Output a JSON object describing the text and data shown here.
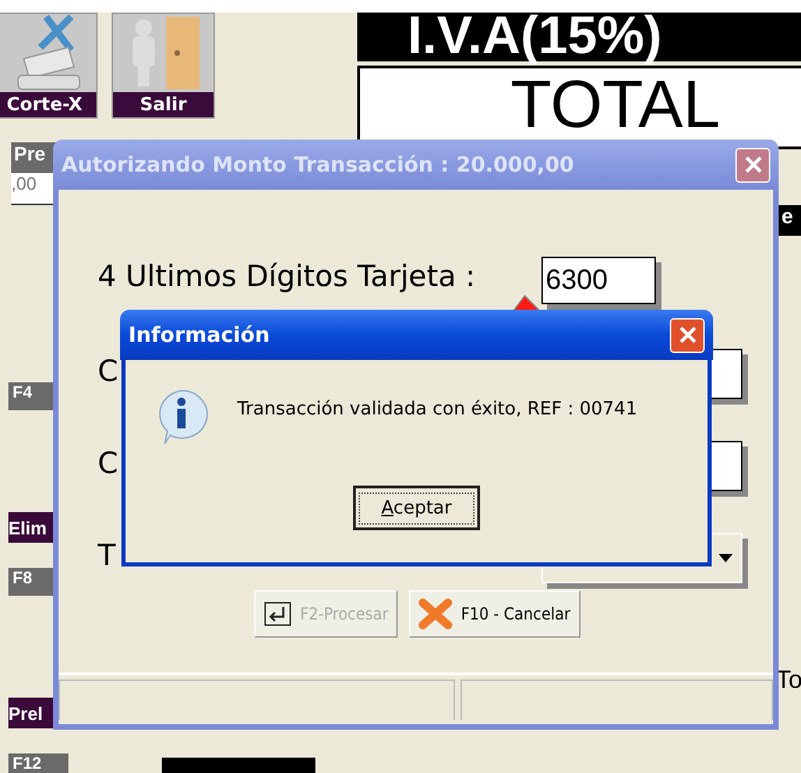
{
  "pos_screen": {
    "toolbar_buttons": [
      {
        "label": "Corte-X",
        "kind": "cut"
      },
      {
        "label": "Salir",
        "kind": "exit"
      }
    ],
    "price_header": "Pre",
    "price_value": ",00",
    "function_keys": [
      {
        "key": "F4",
        "label": "Elim"
      },
      {
        "key": "F8",
        "label": "Prel"
      },
      {
        "key": "F12"
      }
    ],
    "tax_label": "I.V.A(15%)",
    "total_label": "TOTAL",
    "side_header": "e",
    "side_label": "To"
  },
  "auth_dialog": {
    "title": "Autorizando Monto Transacción : 20.000,00",
    "rows": [
      {
        "label": "4 Ultimos Dígitos Tarjeta :",
        "kind": "text",
        "value": "6300"
      },
      {
        "label": "C",
        "kind": "text"
      },
      {
        "label": "C",
        "kind": "text"
      },
      {
        "label": "T",
        "kind": "dropdown"
      }
    ],
    "buttons": [
      {
        "label": "F2-Procesar",
        "kind": "enter",
        "disabled": true
      },
      {
        "label": "F10 - Cancelar",
        "kind": "cancel",
        "disabled": false
      }
    ]
  },
  "info_dialog": {
    "title": "Información",
    "message": "Transacción validada con éxito, REF : 00741",
    "button": "Aceptar"
  }
}
